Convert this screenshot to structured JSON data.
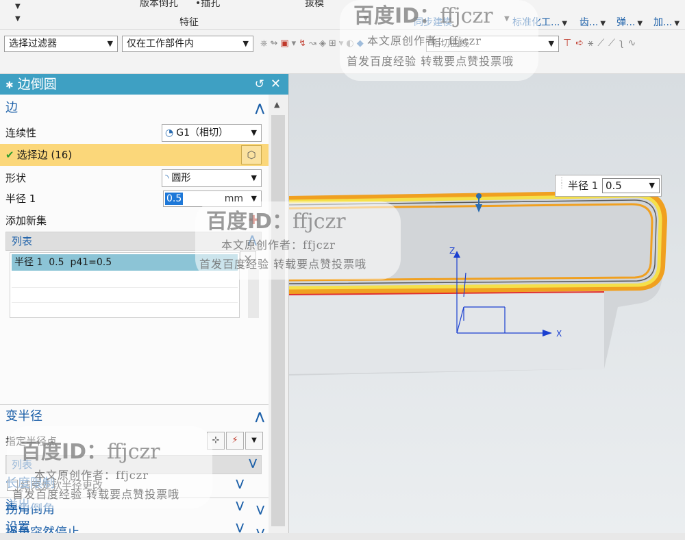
{
  "ribbon": {
    "top_label_1": "版本倒孔",
    "top_label_2": "•插孔",
    "top_label_3": "拔模",
    "group_label": "特征",
    "sync_label": "同步建模",
    "tabs": [
      "标准化工...",
      "齿...",
      "弹...",
      "加..."
    ]
  },
  "selection_bar": {
    "filter": "选择过滤器",
    "scope": "仅在工作部件内",
    "curve_rule": "相切曲线"
  },
  "dialog": {
    "title": "边倒圆",
    "reset_icon": "reset-icon",
    "close_icon": "close-icon",
    "edge_section": {
      "title": "边",
      "continuity_label": "连续性",
      "continuity_value": "G1（相切）",
      "select_edge_label": "选择边 (16)",
      "shape_label": "形状",
      "shape_value": "圆形",
      "radius_label": "半径 1",
      "radius_value": "0.5",
      "radius_unit": "mm",
      "add_set_label": "添加新集",
      "list_label": "列表",
      "list_rows": [
        {
          "name": "半径 1",
          "value": "0.5",
          "expr": "p41=0.5"
        }
      ]
    },
    "var_radius_section": {
      "title": "变半径",
      "point_label": "指定半径点",
      "list_label": "列表",
      "soft_change_label": "结束处软半径更改"
    },
    "collapsed_sections": [
      "拐角倒角",
      "拐角突然停止",
      "长度限制",
      "溢出",
      "设置"
    ]
  },
  "viewport": {
    "radius_tip_label": "半径 1",
    "radius_tip_value": "0.5",
    "axis_z": "Z",
    "axis_x": "X",
    "colors": {
      "edge_highlight": "#f0a020",
      "selected_edge": "#f5e04a",
      "red_edge": "#e03030",
      "csys": "#1a3fd0"
    }
  },
  "watermarks": {
    "brand": "百度ID：",
    "brand_id": "ffjczr",
    "line2": "本文原创作者：ffjczr",
    "line3": "首发百度经验 转载要点赞投票哦"
  }
}
